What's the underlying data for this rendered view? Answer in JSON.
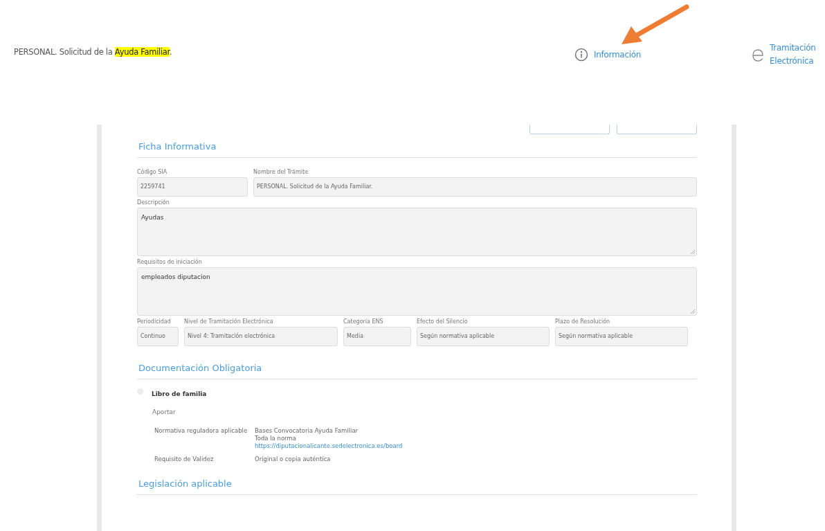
{
  "header": {
    "title_parts": [
      {
        "text": "PERSONAL. Solicitud de la ",
        "highlighted": false
      },
      {
        "text": "Ayuda Familiar",
        "highlighted": true
      },
      {
        "text": ".",
        "highlighted": false
      }
    ],
    "links": [
      {
        "kind": "info",
        "label": "Información"
      },
      {
        "kind": "electronic",
        "label": "Tramitación\nElectrónica"
      }
    ]
  },
  "ficha": {
    "title": "Ficha Informativa",
    "rows": [
      [
        {
          "label": "Código SIA",
          "value": "2259741",
          "kind": "input"
        },
        {
          "label": "Nombre del Trámite",
          "value": "PERSONAL. Solicitud de la Ayuda Familiar.",
          "kind": "input"
        }
      ],
      [
        {
          "label": "Descripción",
          "value": "Ayudas",
          "kind": "textarea"
        }
      ],
      [
        {
          "label": "Requisitos de iniciación",
          "value": "empleados diputacion",
          "kind": "textarea"
        }
      ],
      [
        {
          "label": "Periodicidad",
          "value": "Continuo",
          "kind": "input"
        },
        {
          "label": "Nivel de Tramitación Electrónica",
          "value": "Nivel 4: Tramitación electrónica",
          "kind": "input"
        },
        {
          "label": "Categoría ENS",
          "value": "Media",
          "kind": "input"
        },
        {
          "label": "Efecto del Silencio",
          "value": "Según normativa aplicable",
          "kind": "input"
        },
        {
          "label": "Plazo de Resolución",
          "value": "Según normativa aplicable",
          "kind": "input"
        }
      ]
    ]
  },
  "documentacion": {
    "title": "Documentación Obligatoria",
    "documents": [
      {
        "name": "Libro de familia",
        "action": "Aportar",
        "details": [
          {
            "label": "Normativa reguladora aplicable",
            "lines": [
              {
                "text": "Bases Convocatoria Ayuda Familiar",
                "kind": "text"
              },
              {
                "text": "Toda la norma",
                "kind": "text"
              },
              {
                "text": "https://diputacionalicante.sedelectronica.es/board",
                "kind": "link"
              }
            ]
          },
          {
            "label": "Requisito de Validez",
            "lines": [
              {
                "text": "Original o copia auténtica",
                "kind": "text"
              }
            ]
          }
        ]
      }
    ]
  },
  "legislacion": {
    "title": "Legislación aplicable"
  }
}
